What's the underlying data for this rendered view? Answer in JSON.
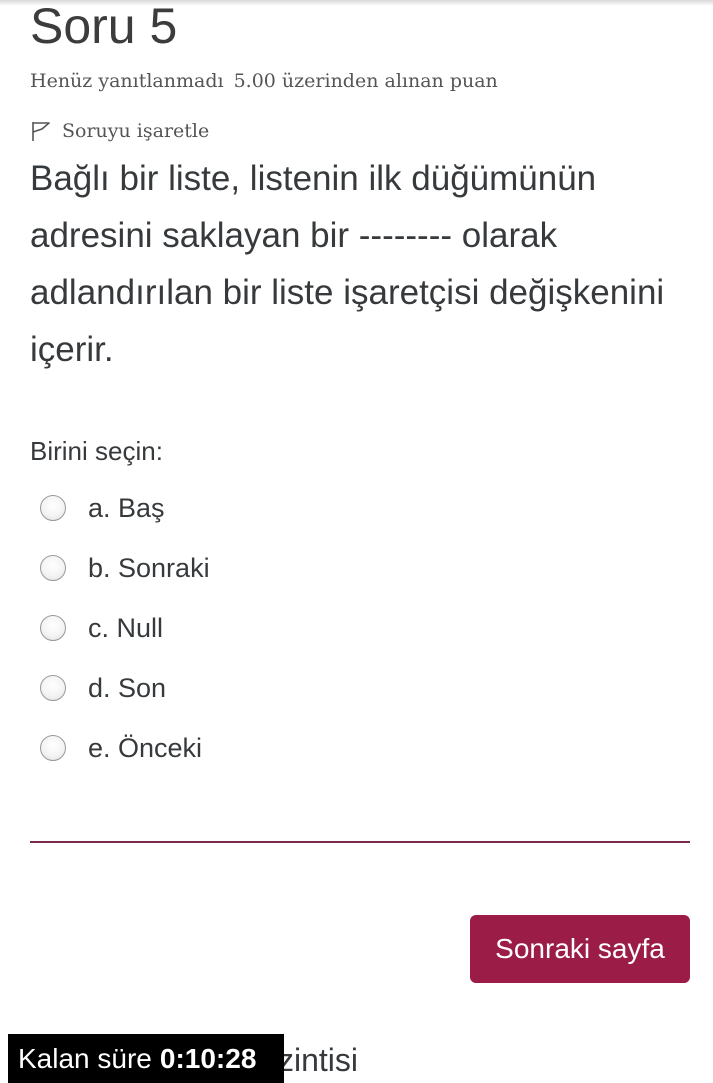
{
  "question": {
    "title": "Soru 5",
    "state": "Henüz yanıtlanmadı",
    "grade": "5.00 üzerinden alınan puan",
    "flag_label": "Soruyu işaretle",
    "text": "Bağlı bir liste, listenin ilk düğümünün adresini saklayan bir -------- olarak adlandırılan bir liste işaretçisi değişkenini içerir.",
    "prompt": "Birini seçin:",
    "answers": [
      {
        "label": "a. Baş",
        "selected": false
      },
      {
        "label": "b. Sonraki",
        "selected": false
      },
      {
        "label": "c. Null",
        "selected": false
      },
      {
        "label": "d. Son",
        "selected": false
      },
      {
        "label": "e. Önceki",
        "selected": false
      }
    ]
  },
  "navigation": {
    "next_label": "Sonraki sayfa"
  },
  "partial_text": "zintisi",
  "timer": {
    "label": "Kalan süre",
    "value": "0:10:28"
  },
  "colors": {
    "accent": "#9c1c48",
    "divider": "#7a2a4a",
    "timer_bg": "#000000"
  },
  "icons": {
    "flag": "flag-outline-icon",
    "radio": "radio-unchecked-icon"
  }
}
